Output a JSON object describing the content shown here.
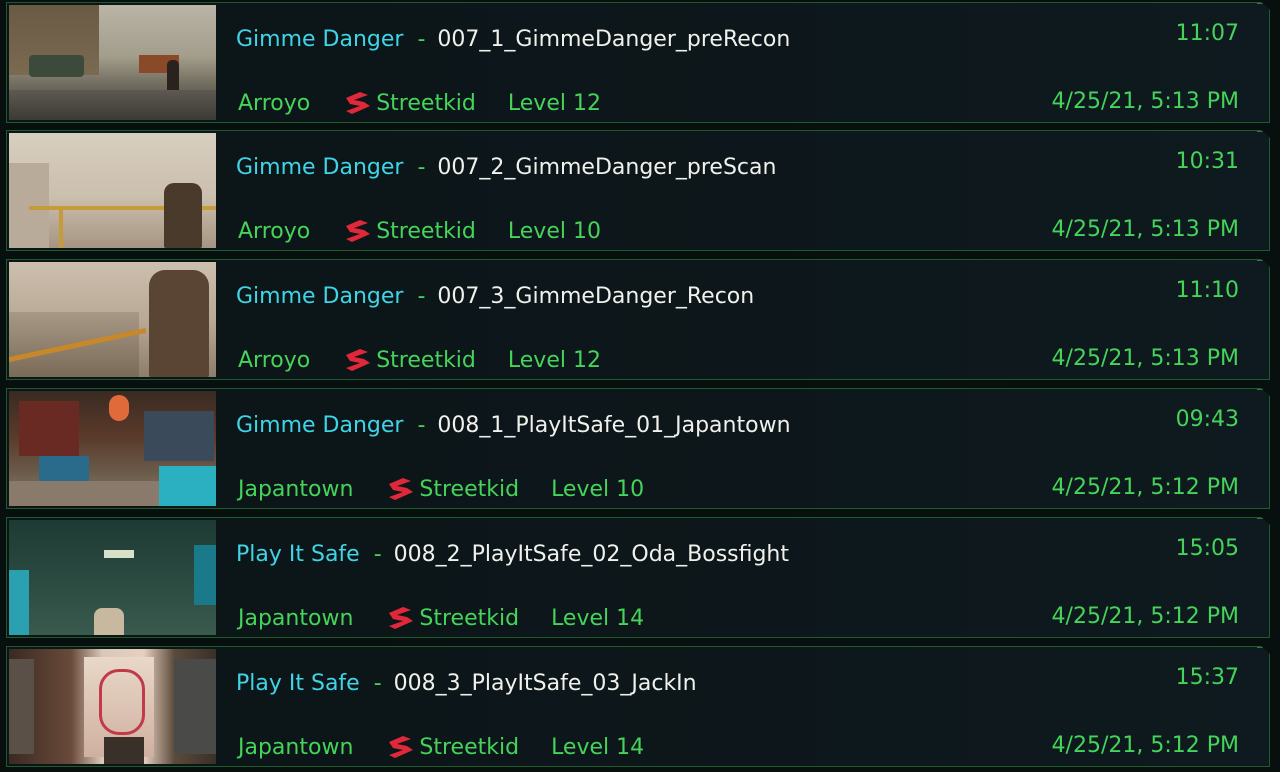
{
  "saves": [
    {
      "quest": "Gimme Danger",
      "separator": "-",
      "save_name": "007_1_GimmeDanger_preRecon",
      "playtime": "11:07",
      "district": "Arroyo",
      "lifepath": "Streetkid",
      "level": "Level 12",
      "date": "4/25/21, 5:13 PM"
    },
    {
      "quest": "Gimme Danger",
      "separator": "-",
      "save_name": "007_2_GimmeDanger_preScan",
      "playtime": "10:31",
      "district": "Arroyo",
      "lifepath": "Streetkid",
      "level": "Level 10",
      "date": "4/25/21, 5:13 PM"
    },
    {
      "quest": "Gimme Danger",
      "separator": "-",
      "save_name": "007_3_GimmeDanger_Recon",
      "playtime": "11:10",
      "district": "Arroyo",
      "lifepath": "Streetkid",
      "level": "Level 12",
      "date": "4/25/21, 5:13 PM"
    },
    {
      "quest": "Gimme Danger",
      "separator": "-",
      "save_name": "008_1_PlayItSafe_01_Japantown",
      "playtime": "09:43",
      "district": "Japantown",
      "lifepath": "Streetkid",
      "level": "Level 10",
      "date": "4/25/21, 5:12 PM"
    },
    {
      "quest": "Play It Safe",
      "separator": "-",
      "save_name": "008_2_PlayItSafe_02_Oda_Bossfight",
      "playtime": "15:05",
      "district": "Japantown",
      "lifepath": "Streetkid",
      "level": "Level 14",
      "date": "4/25/21, 5:12 PM"
    },
    {
      "quest": "Play It Safe",
      "separator": "-",
      "save_name": "008_3_PlayItSafe_03_JackIn",
      "playtime": "15:37",
      "district": "Japantown",
      "lifepath": "Streetkid",
      "level": "Level 14",
      "date": "4/25/21, 5:12 PM"
    }
  ],
  "colors": {
    "quest": "#3fd4e6",
    "accent_green": "#45d35a",
    "save_name": "#f1f1ec",
    "lifepath_icon": "#e0283a",
    "row_border": "#1f5a2c"
  },
  "icons": {
    "lifepath": "streetkid-lifepath-icon"
  }
}
